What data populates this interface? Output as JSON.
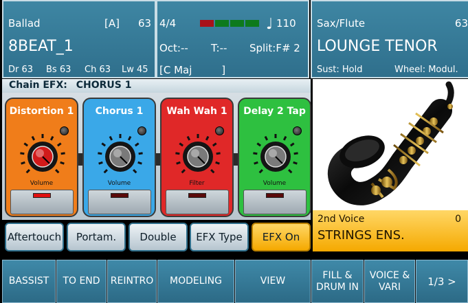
{
  "style_panel": {
    "style_name": "Ballad",
    "variation": "[A]",
    "volume": "63",
    "variation_name": "8BEAT_1",
    "drum": "Dr 63",
    "bass": "Bs 63",
    "chord": "Ch 63",
    "lower": "Lw 45"
  },
  "status_panel": {
    "time_signature": "4/4",
    "tempo": "110",
    "octave": "Oct:--",
    "transpose": "T:--",
    "split": "Split:F# 2",
    "chord": "[C Maj         ]",
    "beat_colors": [
      "#a8121a",
      "#0d7a1c",
      "#0d7a1c",
      "#0d7a1c"
    ]
  },
  "voice_panel": {
    "category": "Sax/Flute",
    "volume": "63",
    "voice_name": "LOUNGE TENOR",
    "sustain": "Sust: Hold",
    "wheel": "Wheel: Modul."
  },
  "chain_efx": {
    "label": "Chain EFX:",
    "value": "CHORUS 1"
  },
  "pedals": [
    {
      "name": "Distortion 1",
      "knob_label": "Volume",
      "color": "#f07d1a",
      "knob_color": "#d11a1a",
      "footswitch_led": "#e01010"
    },
    {
      "name": "Chorus 1",
      "knob_label": "Volume",
      "color": "#3aa8e8",
      "knob_color": "#7a7a7a",
      "footswitch_led": "#5a0a0a"
    },
    {
      "name": "Wah Wah 1",
      "knob_label": "Filter",
      "color": "#e02828",
      "knob_color": "#7a7a7a",
      "footswitch_led": "#5a0a0a"
    },
    {
      "name": "Delay 2 Tap",
      "knob_label": "Volume",
      "color": "#2ec040",
      "knob_color": "#7a7a7a",
      "footswitch_led": "#5a0a0a"
    }
  ],
  "second_voice": {
    "label": "2nd Voice",
    "value": "0",
    "name": "STRINGS ENS."
  },
  "options": [
    {
      "label": "Aftertouch",
      "active": false
    },
    {
      "label": "Portam.",
      "active": false
    },
    {
      "label": "Double",
      "active": false
    },
    {
      "label": "EFX Type",
      "active": false
    },
    {
      "label": "EFX On",
      "active": true
    }
  ],
  "softkeys": [
    {
      "label": "BASSIST"
    },
    {
      "label": "TO END"
    },
    {
      "label": "REINTRO"
    },
    {
      "label": "MODELING"
    },
    {
      "label": "VIEW"
    },
    {
      "label": "FILL &\nDRUM IN"
    },
    {
      "label": "VOICE &\nVARI"
    },
    {
      "label": "1/3 >"
    }
  ]
}
